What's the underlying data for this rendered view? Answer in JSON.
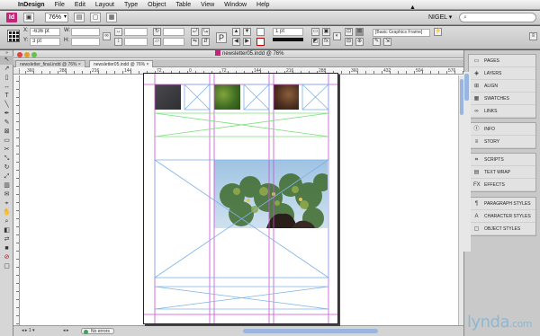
{
  "menubar": {
    "app_name": "InDesign",
    "items": [
      "File",
      "Edit",
      "Layout",
      "Type",
      "Object",
      "Table",
      "View",
      "Window",
      "Help"
    ]
  },
  "appbar": {
    "icon_label": "Id",
    "zoom": "76%",
    "workspace": "NIGEL",
    "workspace_menu_icon": "chevron-down-icon"
  },
  "control": {
    "x_label": "X:",
    "x_value": "-636 pt",
    "y_label": "Y:",
    "y_value": "3 pt",
    "w_label": "W:",
    "h_label": "H:",
    "stroke_weight": "1 pt",
    "object_style": "[Basic Graphics Frame]"
  },
  "document": {
    "window_title": "newsletter05.indd @ 76%",
    "tabs": [
      {
        "label": "newsletter_final.indd @ 76%",
        "active": false
      },
      {
        "label": "newsletter05.indd @ 76%",
        "active": true
      }
    ],
    "ruler_labels": [
      "360",
      "288",
      "216",
      "144",
      "72",
      "0",
      "72",
      "144",
      "216",
      "288",
      "360",
      "432",
      "504",
      "576",
      "648",
      "720",
      "792"
    ],
    "status": {
      "page": "1",
      "errors": "No errors"
    }
  },
  "panels": {
    "group1": [
      {
        "label": "Pages",
        "icon": "pages-icon",
        "glyph": "▭"
      },
      {
        "label": "Layers",
        "icon": "layers-icon",
        "glyph": "◈"
      },
      {
        "label": "Align",
        "icon": "align-icon",
        "glyph": "⊞"
      },
      {
        "label": "Swatches",
        "icon": "swatches-icon",
        "glyph": "▦"
      },
      {
        "label": "Links",
        "icon": "links-icon",
        "glyph": "∞"
      }
    ],
    "group2": [
      {
        "label": "Info",
        "icon": "info-icon",
        "glyph": "ⓘ"
      },
      {
        "label": "Story",
        "icon": "story-icon",
        "glyph": "≡"
      }
    ],
    "group3": [
      {
        "label": "Scripts",
        "icon": "scripts-icon",
        "glyph": "⌗"
      },
      {
        "label": "Text Wrap",
        "icon": "text-wrap-icon",
        "glyph": "▤"
      },
      {
        "label": "Effects",
        "icon": "effects-icon",
        "glyph": "fx"
      }
    ],
    "group4": [
      {
        "label": "Paragraph Styles",
        "icon": "paragraph-styles-icon",
        "glyph": "¶"
      },
      {
        "label": "Character Styles",
        "icon": "character-styles-icon",
        "glyph": "A"
      },
      {
        "label": "Object Styles",
        "icon": "object-styles-icon",
        "glyph": "▢"
      }
    ]
  },
  "watermark": {
    "text": "lynda",
    "suffix": ".com"
  },
  "colors": {
    "accent_magenta": "#c0277a",
    "guide_magenta": "#c84fd0",
    "guide_green": "#7ee07e",
    "frame_blue": "#7fb2e6",
    "scroll_blue": "#9ab6de"
  }
}
